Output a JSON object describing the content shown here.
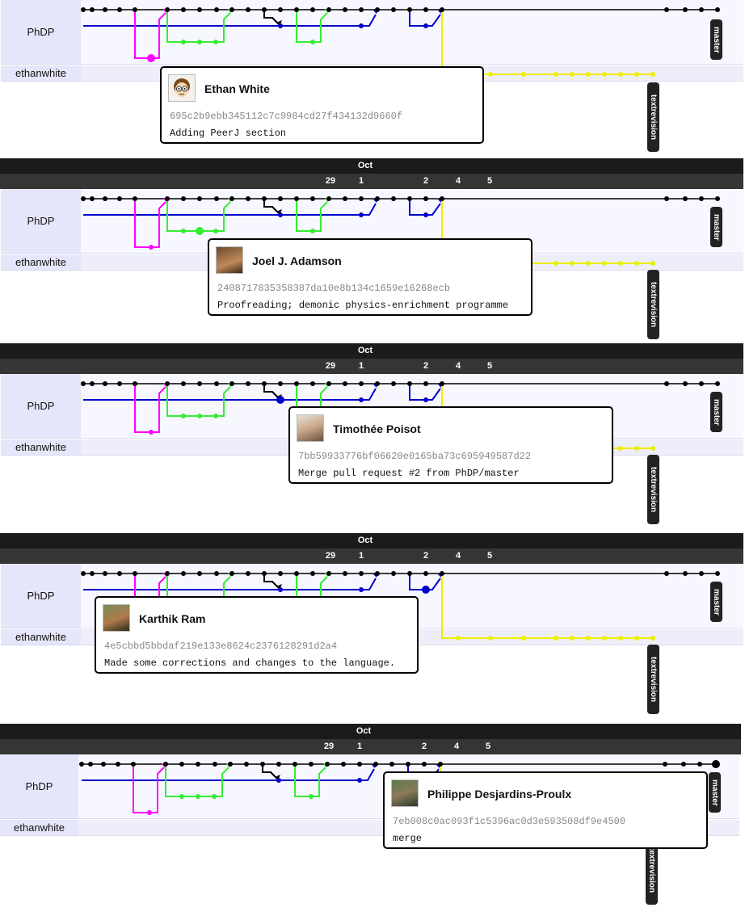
{
  "month_label": "Oct",
  "day_labels": [
    "29",
    "1",
    "2",
    "4",
    "5"
  ],
  "rows": [
    "PhDP",
    "ethanwhite"
  ],
  "tags": {
    "master": "master",
    "textrevision": "textrevision"
  },
  "colors": {
    "master": "#000000",
    "phdp_branch": "#0000cc",
    "magenta": "#ff00ff",
    "green": "#33ee33",
    "yellow": "#eeee00"
  },
  "panels": [
    {
      "id": "p1",
      "popup": {
        "author": "Ethan White",
        "sha": "695c2b9ebb345112c7c9984cd27f434132d9660f",
        "message": "Adding PeerJ section",
        "avatar": "cartoon-face-avatar"
      }
    },
    {
      "id": "p2",
      "popup": {
        "author": "Joel J. Adamson",
        "sha": "2408717835358387da10e8b134c1659e16268ecb",
        "message": "Proofreading; demonic physics-enrichment programme",
        "avatar": "photo-avatar"
      }
    },
    {
      "id": "p3",
      "popup": {
        "author": "Timothée Poisot",
        "sha": "7bb59933776bf06620e0165ba73c695949587d22",
        "message": "Merge pull request #2 from PhDP/master",
        "avatar": "photo-avatar"
      }
    },
    {
      "id": "p4",
      "popup": {
        "author": "Karthik Ram",
        "sha": "4e5cbbd5bbdaf219e133e8624c2376128291d2a4",
        "message": "Made some corrections and changes to the language.",
        "avatar": "photo-avatar"
      }
    },
    {
      "id": "p5",
      "popup": {
        "author": "Philippe Desjardins-Proulx",
        "sha": "7eb008c0ac093f1c5396ac0d3e593508df9e4500",
        "message": "merge",
        "avatar": "photo-avatar"
      }
    }
  ]
}
